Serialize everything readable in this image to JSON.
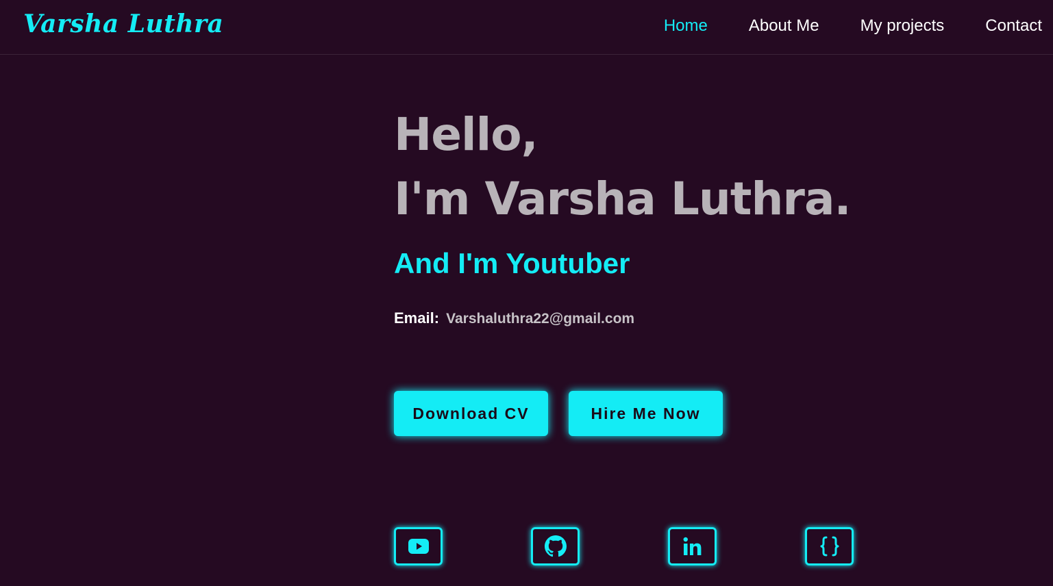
{
  "header": {
    "logo": "Varsha Luthra",
    "nav": [
      {
        "label": "Home",
        "active": true
      },
      {
        "label": "About Me",
        "active": false
      },
      {
        "label": "My projects",
        "active": false
      },
      {
        "label": "Contact",
        "active": false
      }
    ]
  },
  "hero": {
    "greeting_line1": "Hello,",
    "greeting_line2": "I'm Varsha Luthra.",
    "subtitle": "And I'm Youtuber",
    "email_label": "Email:",
    "email_value": "Varshaluthra22@gmail.com",
    "buttons": {
      "download": "Download CV",
      "hire": "Hire Me Now"
    }
  },
  "socials": [
    {
      "icon": "youtube-icon"
    },
    {
      "icon": "github-icon"
    },
    {
      "icon": "linkedin-icon"
    },
    {
      "icon": "code-braces-icon"
    }
  ],
  "colors": {
    "background": "#250a22",
    "accent": "#14ecf5",
    "heading_gray": "#b8b3b8",
    "white": "#ffffff"
  }
}
